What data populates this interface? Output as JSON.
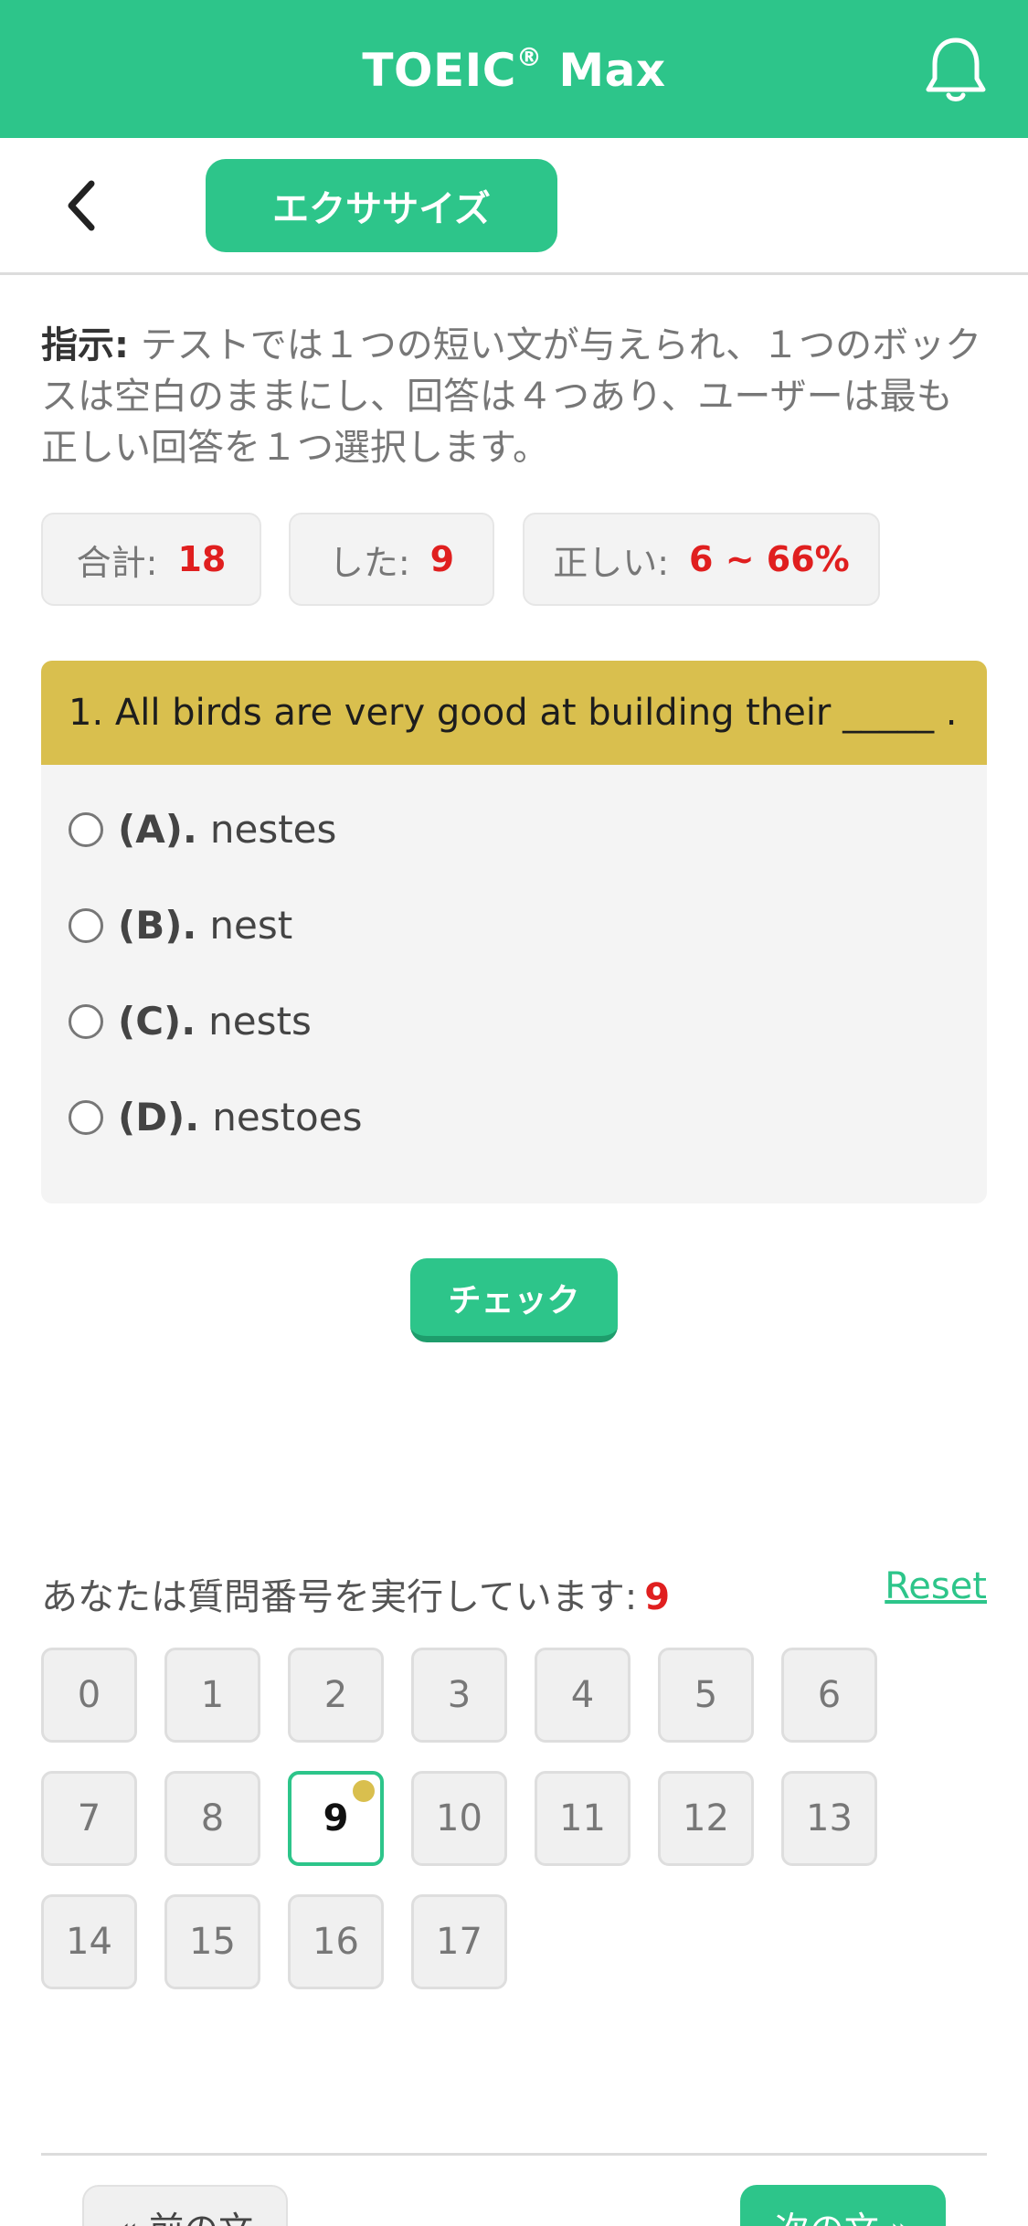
{
  "header": {
    "title": "TOEIC",
    "title_mark": "®",
    "title_suffix": " Max",
    "bell_icon": "bell-icon"
  },
  "subnav": {
    "back_icon": "chevron-left-icon",
    "tab_label": "エクササイズ"
  },
  "instructions": {
    "label": "指示:",
    "text": " テストでは１つの短い文が与えられ、１つのボックスは空白のままにし、回答は４つあり、ユーザーは最も正しい回答を１つ選択します。"
  },
  "stats": [
    {
      "label": "合計:",
      "value": "18"
    },
    {
      "label": "した:",
      "value": "9"
    },
    {
      "label": "正しい:",
      "value": "6 ~ 66%"
    }
  ],
  "question": {
    "text": "1. All birds are very good at building their _____ .",
    "options": [
      {
        "key": "(A).",
        "text": "nestes"
      },
      {
        "key": "(B).",
        "text": "nest"
      },
      {
        "key": "(C).",
        "text": "nests"
      },
      {
        "key": "(D).",
        "text": "nestoes"
      }
    ]
  },
  "check_label": "チェック",
  "progress": {
    "label": "あなたは質問番号を実行しています:",
    "current": "9",
    "reset_label": "Reset"
  },
  "numbers": [
    "0",
    "1",
    "2",
    "3",
    "4",
    "5",
    "6",
    "7",
    "8",
    "9",
    "10",
    "11",
    "12",
    "13",
    "14",
    "15",
    "16",
    "17"
  ],
  "active_number": "9",
  "nav": {
    "prev_label": "« 前の文",
    "next_label": "次の文 »"
  },
  "colors": {
    "accent": "#2dc58a",
    "question_header": "#d9bf4e",
    "highlight": "#e01f1f"
  }
}
